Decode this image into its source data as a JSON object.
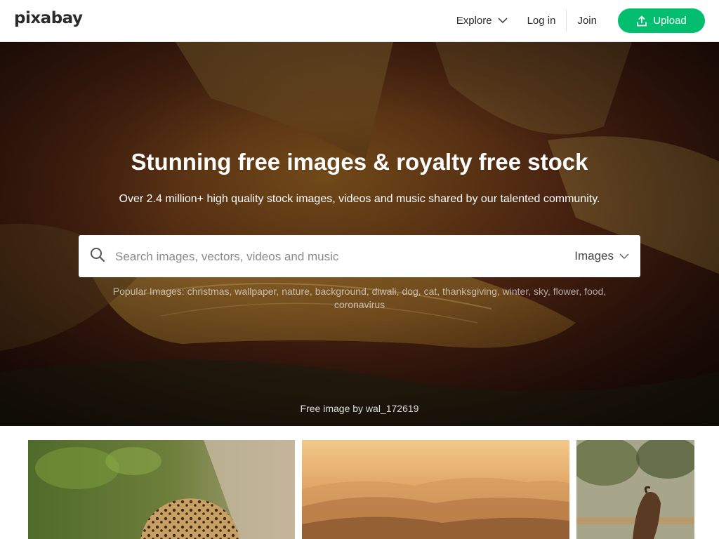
{
  "header": {
    "logo": "pixabay",
    "nav": {
      "explore": "Explore",
      "login": "Log in",
      "join": "Join",
      "upload": "Upload"
    }
  },
  "hero": {
    "title": "Stunning free images & royalty free stock",
    "subtitle": "Over 2.4 million+ high quality stock images, videos and music shared by our talented community.",
    "search": {
      "placeholder": "Search images, vectors, videos and music",
      "type": "Images"
    },
    "popular": {
      "label": "Popular Images:",
      "tags": [
        "christmas",
        "wallpaper",
        "nature",
        "background",
        "diwali",
        "dog",
        "cat",
        "thanksgiving",
        "winter",
        "sky",
        "flower",
        "food",
        "coronavirus"
      ]
    },
    "credit": "Free image by wal_172619"
  },
  "colors": {
    "accent": "#02be6e"
  },
  "gallery": {
    "photos": [
      "leopard-photo",
      "mountains-photo",
      "horse-photo"
    ]
  }
}
